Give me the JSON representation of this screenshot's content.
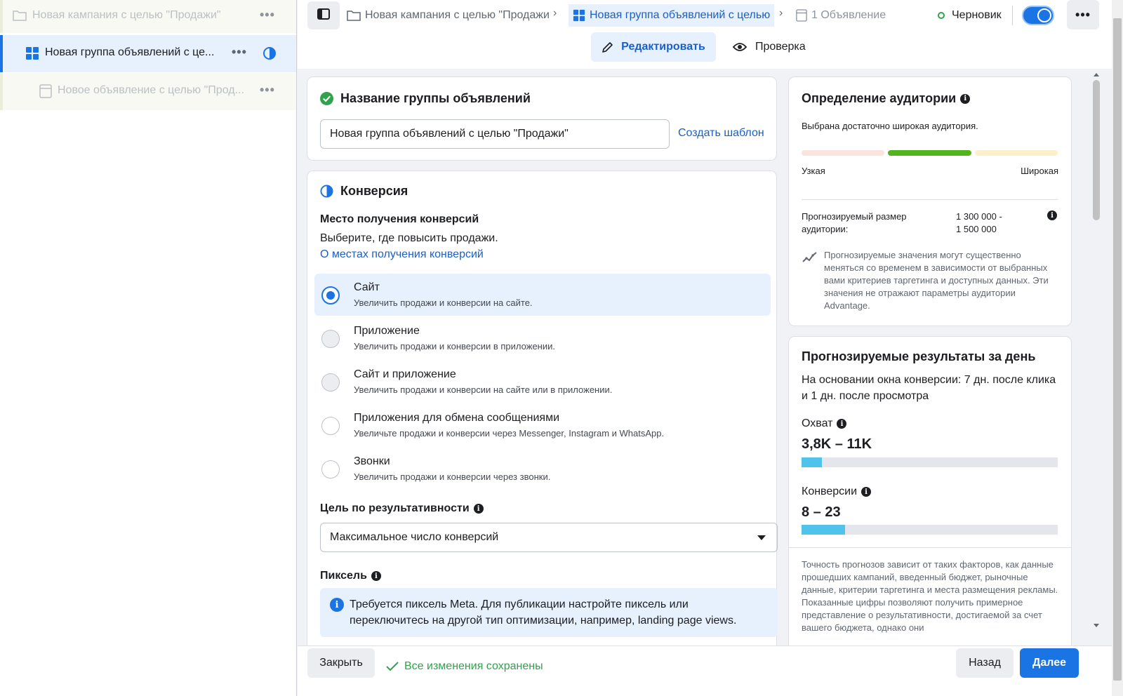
{
  "tree": {
    "campaign_label": "Новая кампания с целью \"Продажи\"",
    "adset_label": "Новая группа объявлений с це...",
    "ad_label": "Новое объявление с целью \"Прод...",
    "more": "•••"
  },
  "topbar": {
    "crumb_campaign": "Новая кампания с целью \"Продажи",
    "crumb_adset": "Новая группа объявлений с целью",
    "crumb_ad": "1 Объявление",
    "separator": "›",
    "status": "Черновик",
    "more": "•••",
    "tab_edit": "Редактировать",
    "tab_review": "Проверка",
    "toggle_on": true
  },
  "adset_name": {
    "title": "Название группы объявлений",
    "value": "Новая группа объявлений с целью \"Продажи\"",
    "template_link": "Создать шаблон"
  },
  "conversion": {
    "title": "Конверсия",
    "location_heading": "Место получения конверсий",
    "location_desc": "Выберите, где повысить продажи.",
    "location_link": "О местах получения конверсий",
    "options": [
      {
        "title": "Сайт",
        "sub": "Увеличить продажи и конверсии на сайте.",
        "selected": true
      },
      {
        "title": "Приложение",
        "sub": "Увеличить продажи и конверсии в приложении.",
        "selected": false
      },
      {
        "title": "Сайт и приложение",
        "sub": "Увеличить продажи и конверсии на сайте или в приложении.",
        "selected": false
      },
      {
        "title": "Приложения для обмена сообщениями",
        "sub": "Увеличьте продажи и конверсии через Messenger, Instagram и WhatsApp.",
        "selected": false
      },
      {
        "title": "Звонки",
        "sub": "Увеличить продажи и конверсии через звонки.",
        "selected": false
      }
    ],
    "goal_heading": "Цель по результативности",
    "goal_value": "Максимальное число конверсий",
    "pixel_heading": "Пиксель",
    "pixel_notice": "Требуется пиксель Meta. Для публикации настройте пиксель или переключитесь на другой тип оптимизации, например, landing page views."
  },
  "audience": {
    "title": "Определение аудитории",
    "status": "Выбрана достаточно широкая аудитория.",
    "narrow": "Узкая",
    "wide": "Широкая",
    "size_label": "Прогнозируемый размер аудитории:",
    "size_line1": "1 300 000 -",
    "size_line2": "1 500 000",
    "note": "Прогнозируемые значения могут существенно меняться со временем в зависимости от выбранных вами критериев таргетинга и доступных данных. Эти значения не отражают параметры аудитории Advantage.",
    "colors": {
      "narrow": "#fbe3df",
      "mid": "#54b41e",
      "wide": "#fcf0cc"
    }
  },
  "results": {
    "title": "Прогнозируемые результаты за день",
    "window": "На основании окна конверсии: 7 дн. после клика и 1 дн. после просмотра",
    "reach_label": "Охват",
    "reach_value": "3,8K – 11K",
    "reach_fill": 0.08,
    "conv_label": "Конверсии",
    "conv_value": "8 – 23",
    "conv_fill": 0.17,
    "accuracy_note": "Точность прогнозов зависит от таких факторов, как данные прошедших кампаний, введенный бюджет, рыночные данные, критерии таргетинга и места размещения рекламы. Показанные цифры позволяют получить примерное представление о результативности, достигаемой за счет вашего бюджета, однако они"
  },
  "footer": {
    "close": "Закрыть",
    "saved": "Все изменения сохранены",
    "back": "Назад",
    "next": "Далее"
  }
}
